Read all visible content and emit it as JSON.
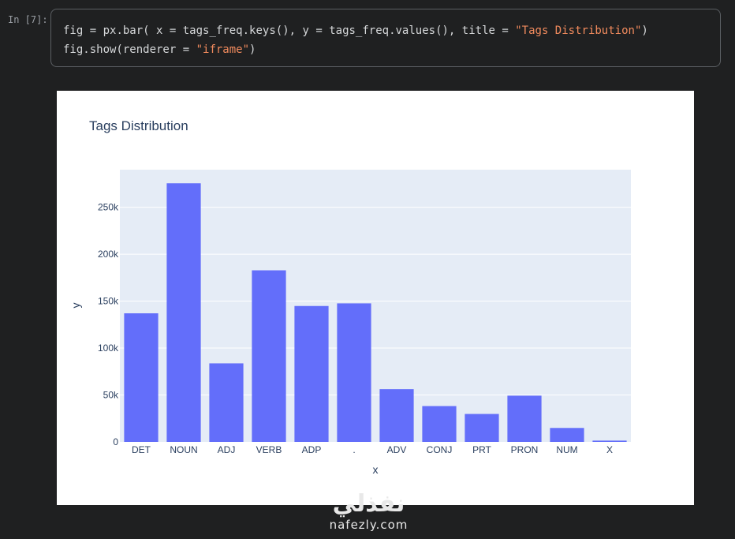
{
  "cell": {
    "prompt": "In [7]:",
    "line1": {
      "p1": "fig",
      "p2": " = ",
      "p3": "px.bar( x ",
      "p4": "=",
      "p5": " tags_freq.keys(), y ",
      "p6": "=",
      "p7": " tags_freq.values(), title ",
      "p8": "=",
      "p9": " ",
      "p10": "\"Tags Distribution\"",
      "p11": ")"
    },
    "line2": {
      "p1": "fig.show(renderer ",
      "p2": "=",
      "p3": " ",
      "p4": "\"iframe\"",
      "p5": ")"
    }
  },
  "watermark": {
    "mark": "نفذلي",
    "text": "nafezly.com"
  },
  "colors": {
    "bar": "#636efa",
    "plot_bg": "#e5ecf6",
    "grid": "#ffffff",
    "text": "#2a3f5f"
  },
  "chart_data": {
    "type": "bar",
    "title": "Tags Distribution",
    "xlabel": "x",
    "ylabel": "y",
    "categories": [
      "DET",
      "NOUN",
      "ADJ",
      "VERB",
      "ADP",
      ".",
      "ADV",
      "CONJ",
      "PRT",
      "PRON",
      "NUM",
      "X"
    ],
    "values": [
      137000,
      275500,
      83700,
      182800,
      144800,
      147600,
      56200,
      38200,
      29800,
      49300,
      14900,
      1400
    ],
    "ylim": [
      0,
      290000
    ],
    "yticks": [
      0,
      50000,
      100000,
      150000,
      200000,
      250000
    ],
    "ytick_labels": [
      "0",
      "50k",
      "100k",
      "150k",
      "200k",
      "250k"
    ],
    "grid": true,
    "legend": "none"
  }
}
